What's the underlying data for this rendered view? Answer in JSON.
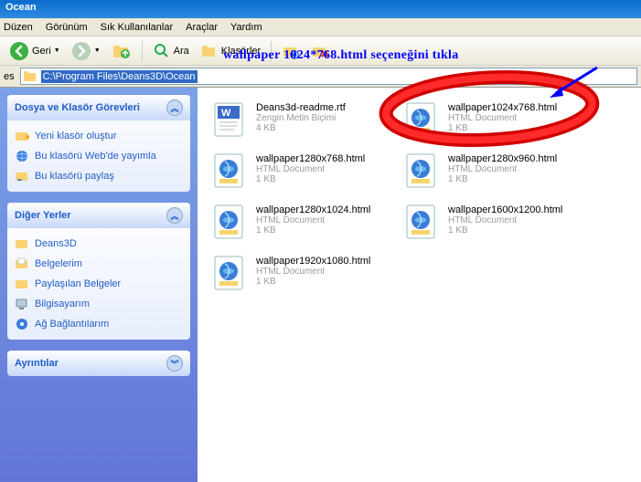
{
  "window": {
    "title": "Ocean"
  },
  "menu": {
    "items": [
      "Düzen",
      "Görünüm",
      "Sık Kullanılanlar",
      "Araçlar",
      "Yardım"
    ]
  },
  "toolbar": {
    "back": "Geri",
    "search": "Ara",
    "folders": "Klasörler"
  },
  "address": {
    "label": "es",
    "path": "C:\\Program Files\\Deans3D\\Ocean"
  },
  "sidebar": {
    "panel1": {
      "title": "Dosya ve Klasör Görevleri",
      "tasks": [
        "Yeni klasör oluştur",
        "Bu klasörü Web'de yayımla",
        "Bu klasörü paylaş"
      ]
    },
    "panel2": {
      "title": "Diğer Yerler",
      "tasks": [
        "Deans3D",
        "Belgelerim",
        "Paylaşılan Belgeler",
        "Bilgisayarım",
        "Ağ Bağlantılarım"
      ]
    },
    "panel3": {
      "title": "Ayrıntılar"
    }
  },
  "files": [
    {
      "name": "Deans3d-readme.rtf",
      "type": "Zengin Metin Biçimi",
      "size": "4 KB",
      "icon": "rtf"
    },
    {
      "name": "wallpaper1024x768.html",
      "type": "HTML Document",
      "size": "1 KB",
      "icon": "html"
    },
    {
      "name": "wallpaper1280x768.html",
      "type": "HTML Document",
      "size": "1 KB",
      "icon": "html"
    },
    {
      "name": "wallpaper1280x960.html",
      "type": "HTML Document",
      "size": "1 KB",
      "icon": "html"
    },
    {
      "name": "wallpaper1280x1024.html",
      "type": "HTML Document",
      "size": "1 KB",
      "icon": "html"
    },
    {
      "name": "wallpaper1600x1200.html",
      "type": "HTML Document",
      "size": "1 KB",
      "icon": "html"
    },
    {
      "name": "wallpaper1920x1080.html",
      "type": "HTML Document",
      "size": "1 KB",
      "icon": "html"
    }
  ],
  "annotation": {
    "text": "wallpaper 1024*768.html seçeneğini tıkla"
  }
}
